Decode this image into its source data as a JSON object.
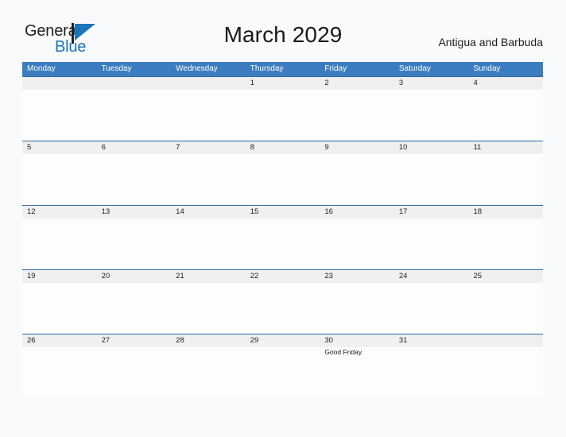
{
  "brand": {
    "name_part1": "General",
    "name_part2": "Blue",
    "mark_icon": "blue-triangle-flag-icon",
    "accent_color": "#1b75bb"
  },
  "header": {
    "title": "March 2029",
    "locale": "Antigua and Barbuda"
  },
  "colors": {
    "weekday_header_bg": "#3c7dbf",
    "date_band_bg": "#f0f0f0",
    "date_band_border": "#2e6da4",
    "page_bg": "#f8fafc"
  },
  "calendar": {
    "weekdays": [
      "Monday",
      "Tuesday",
      "Wednesday",
      "Thursday",
      "Friday",
      "Saturday",
      "Sunday"
    ],
    "weeks": [
      [
        {
          "date": "",
          "event": ""
        },
        {
          "date": "",
          "event": ""
        },
        {
          "date": "",
          "event": ""
        },
        {
          "date": "1",
          "event": ""
        },
        {
          "date": "2",
          "event": ""
        },
        {
          "date": "3",
          "event": ""
        },
        {
          "date": "4",
          "event": ""
        }
      ],
      [
        {
          "date": "5",
          "event": ""
        },
        {
          "date": "6",
          "event": ""
        },
        {
          "date": "7",
          "event": ""
        },
        {
          "date": "8",
          "event": ""
        },
        {
          "date": "9",
          "event": ""
        },
        {
          "date": "10",
          "event": ""
        },
        {
          "date": "11",
          "event": ""
        }
      ],
      [
        {
          "date": "12",
          "event": ""
        },
        {
          "date": "13",
          "event": ""
        },
        {
          "date": "14",
          "event": ""
        },
        {
          "date": "15",
          "event": ""
        },
        {
          "date": "16",
          "event": ""
        },
        {
          "date": "17",
          "event": ""
        },
        {
          "date": "18",
          "event": ""
        }
      ],
      [
        {
          "date": "19",
          "event": ""
        },
        {
          "date": "20",
          "event": ""
        },
        {
          "date": "21",
          "event": ""
        },
        {
          "date": "22",
          "event": ""
        },
        {
          "date": "23",
          "event": ""
        },
        {
          "date": "24",
          "event": ""
        },
        {
          "date": "25",
          "event": ""
        }
      ],
      [
        {
          "date": "26",
          "event": ""
        },
        {
          "date": "27",
          "event": ""
        },
        {
          "date": "28",
          "event": ""
        },
        {
          "date": "29",
          "event": ""
        },
        {
          "date": "30",
          "event": "Good Friday"
        },
        {
          "date": "31",
          "event": ""
        },
        {
          "date": "",
          "event": ""
        }
      ]
    ]
  }
}
